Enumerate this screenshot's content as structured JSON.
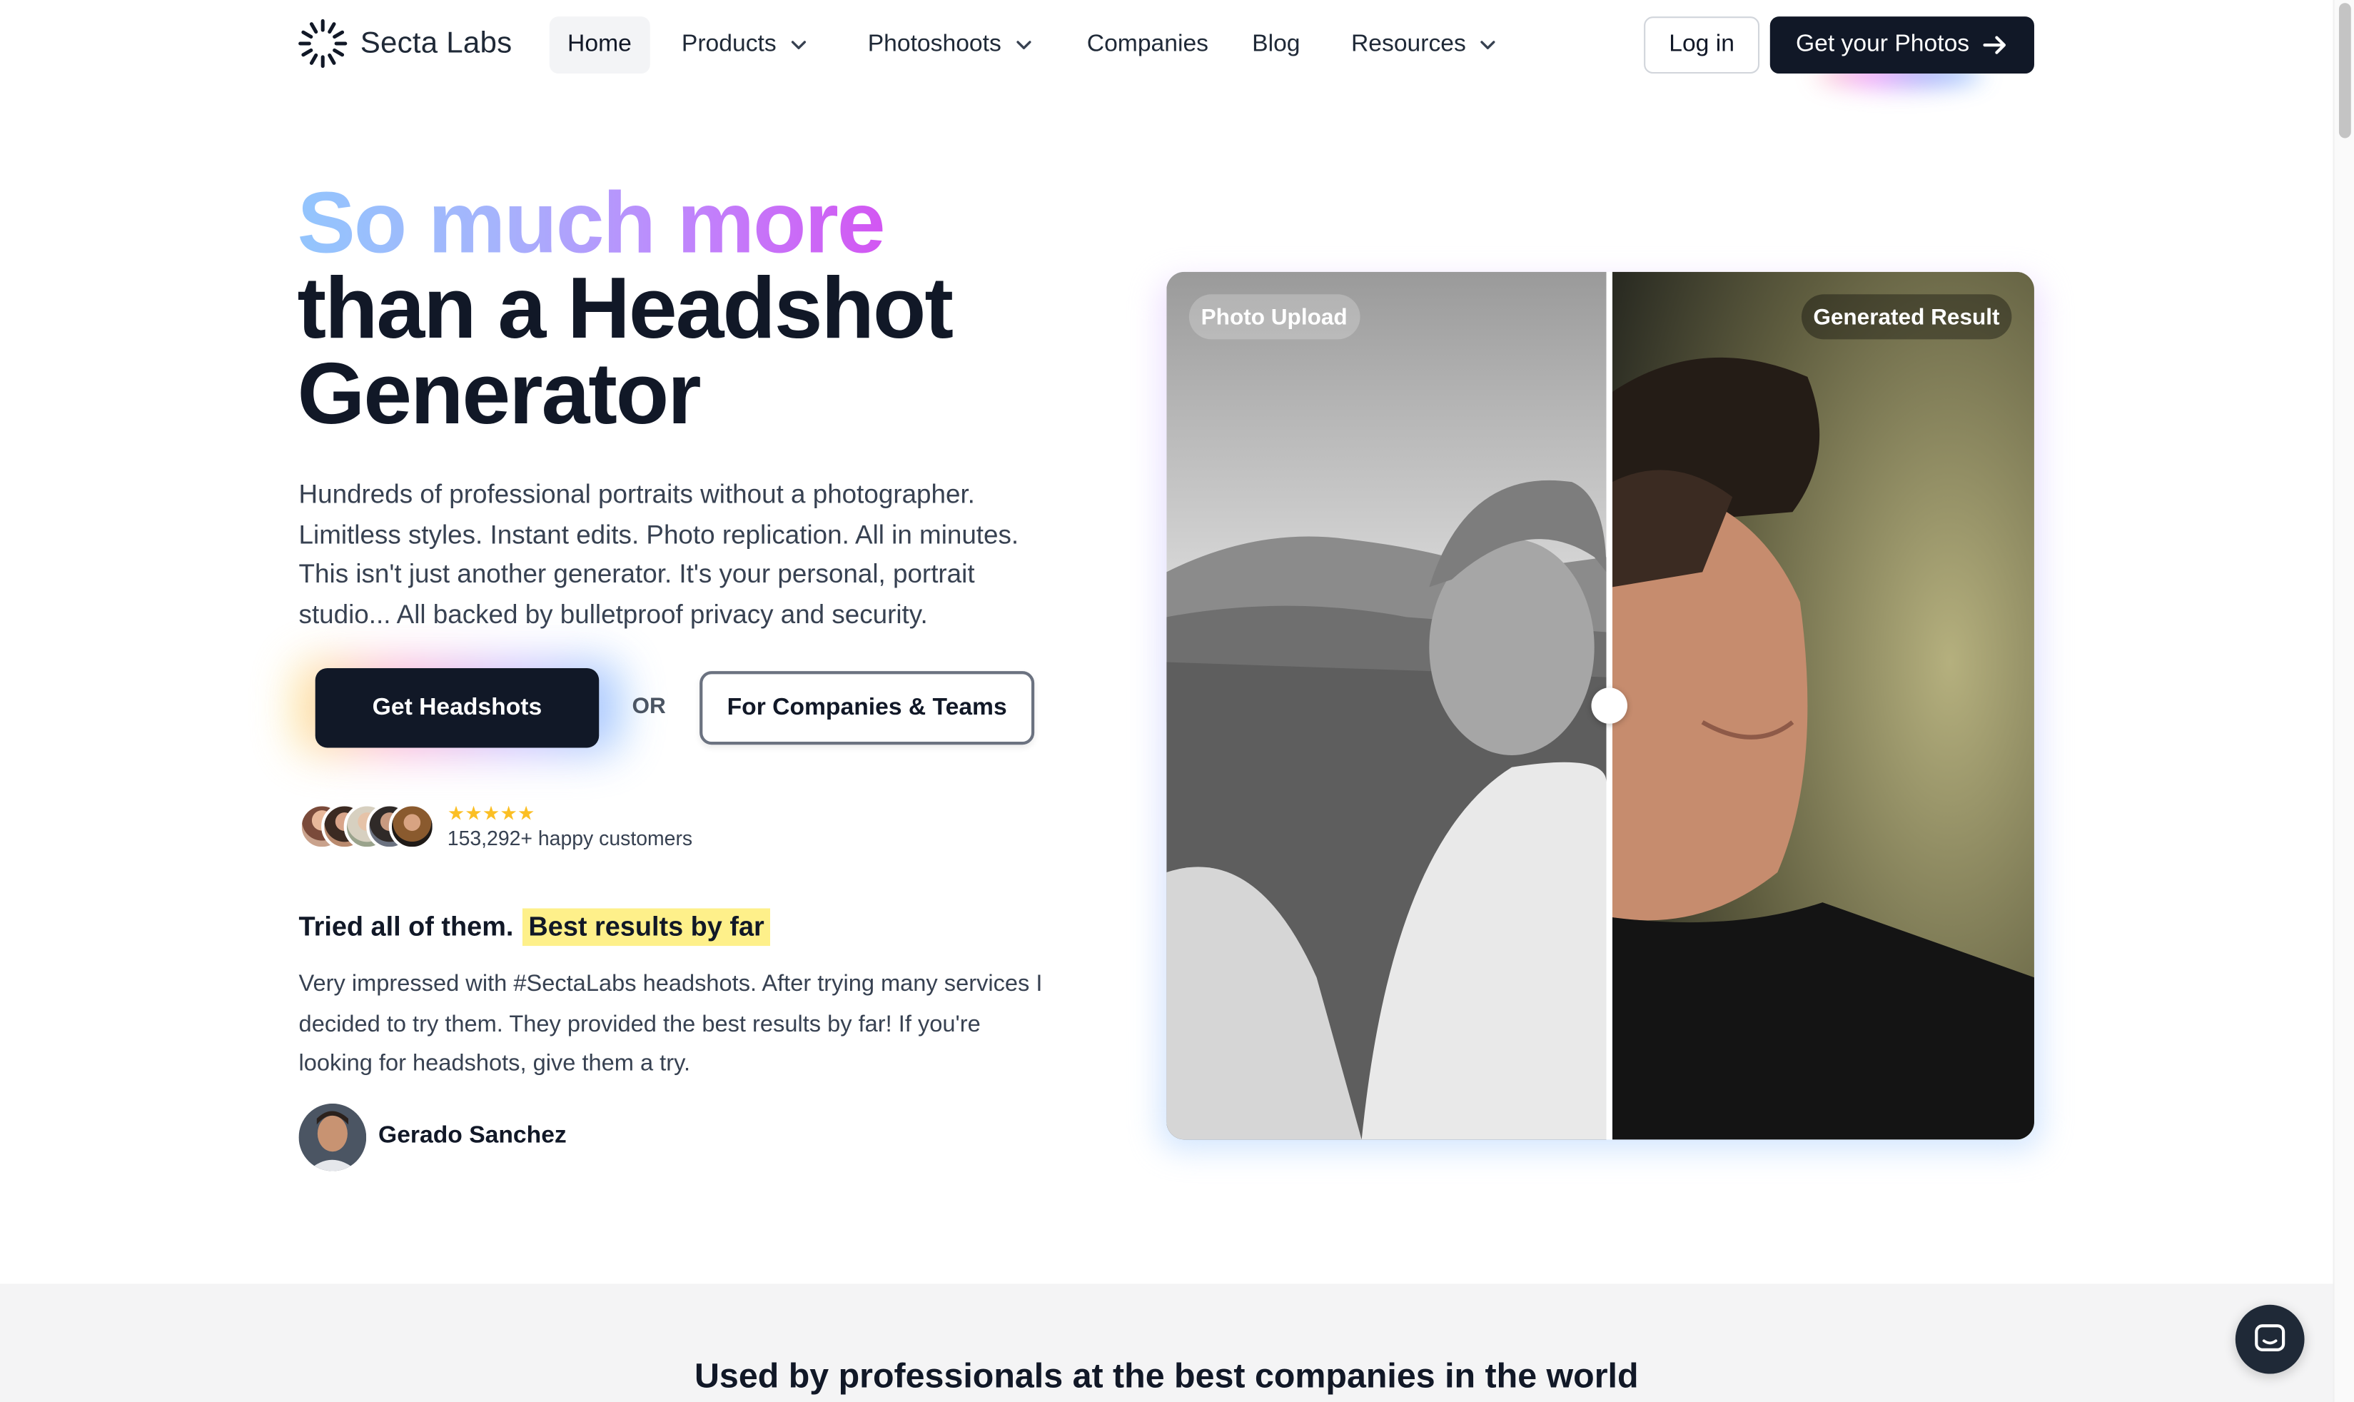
{
  "brand": {
    "name": "Secta Labs"
  },
  "nav": {
    "items": [
      {
        "label": "Home",
        "active": true,
        "dropdown": false
      },
      {
        "label": "Products",
        "dropdown": true
      },
      {
        "label": "Photoshoots",
        "dropdown": true
      },
      {
        "label": "Companies",
        "dropdown": false
      },
      {
        "label": "Blog",
        "dropdown": false
      },
      {
        "label": "Resources",
        "dropdown": true
      }
    ],
    "login_label": "Log in",
    "cta_label": "Get your Photos"
  },
  "hero": {
    "title_gradient": "So much more",
    "title_line2": "than a Headshot",
    "title_line3": "Generator",
    "lead": "Hundreds of professional portraits without a photographer. Limitless styles. Instant edits. Photo replication. All in minutes. This isn't just another generator. It's your personal, portrait studio... All backed by bulletproof privacy and security.",
    "primary_cta": "Get Headshots",
    "or": "OR",
    "secondary_cta": "For Companies & Teams",
    "rating_stars": "★★★★★",
    "customers": "153,292+ happy customers"
  },
  "testimonial": {
    "title": "Tried all of them.",
    "highlight": "Best results by far",
    "body": "Very impressed with #SectaLabs headshots. After trying many services I decided to try them. They provided the best results by far! If you're looking for headshots, give them a try.",
    "author": "Gerado Sanchez"
  },
  "compare": {
    "left_tag": "Photo Upload",
    "right_tag": "Generated Result"
  },
  "band": {
    "title": "Used by professionals at the best companies in the world"
  },
  "colors": {
    "dark": "#111827",
    "highlight": "#fef08a",
    "stars": "#fbbf24"
  }
}
